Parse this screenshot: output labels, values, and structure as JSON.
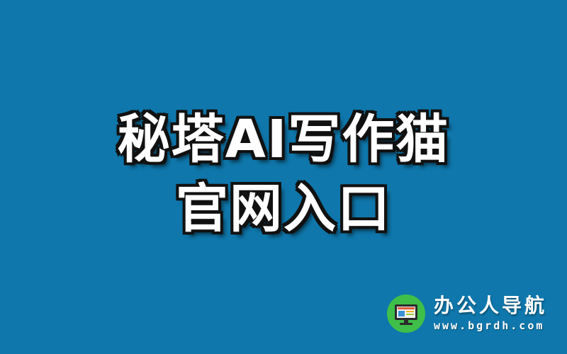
{
  "headline": {
    "line1": "秘塔AI写作猫",
    "line2": "官网入口"
  },
  "brand": {
    "name": "办公人导航",
    "url": "www.bgrdh.com",
    "logo_icon": "monitor-icon"
  },
  "colors": {
    "background": "#0f77ab",
    "headline_fill": "#ffffff",
    "headline_outline": "#111111",
    "logo_circle": "#3fbf49"
  }
}
